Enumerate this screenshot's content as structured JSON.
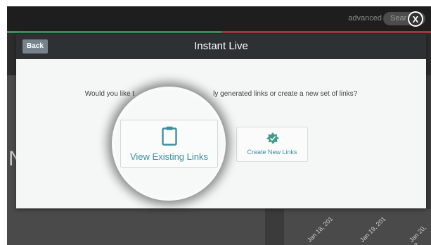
{
  "header": {
    "advanced_label": "advanced",
    "search_placeholder": "Sear",
    "close_label": "X"
  },
  "background": {
    "letter": "N",
    "dates": [
      "Jan 18, 201",
      "Jan 19, 201",
      "Jan 20, 2"
    ]
  },
  "modal": {
    "back_label": "Back",
    "title": "Instant Live",
    "question_left": "Would you like t",
    "question_right": "ly generated links or create a new set of links?",
    "view_existing_label": "View Existing Links",
    "create_new_label": "Create New Links"
  },
  "colors": {
    "accent_teal": "#3f8fa0",
    "header_dark": "#2e3133",
    "progress_green": "#3d8f5b",
    "progress_red": "#a33a3a"
  },
  "icons": {
    "view_existing": "clipboard-icon",
    "create_new": "badge-icon",
    "close": "close-icon"
  }
}
